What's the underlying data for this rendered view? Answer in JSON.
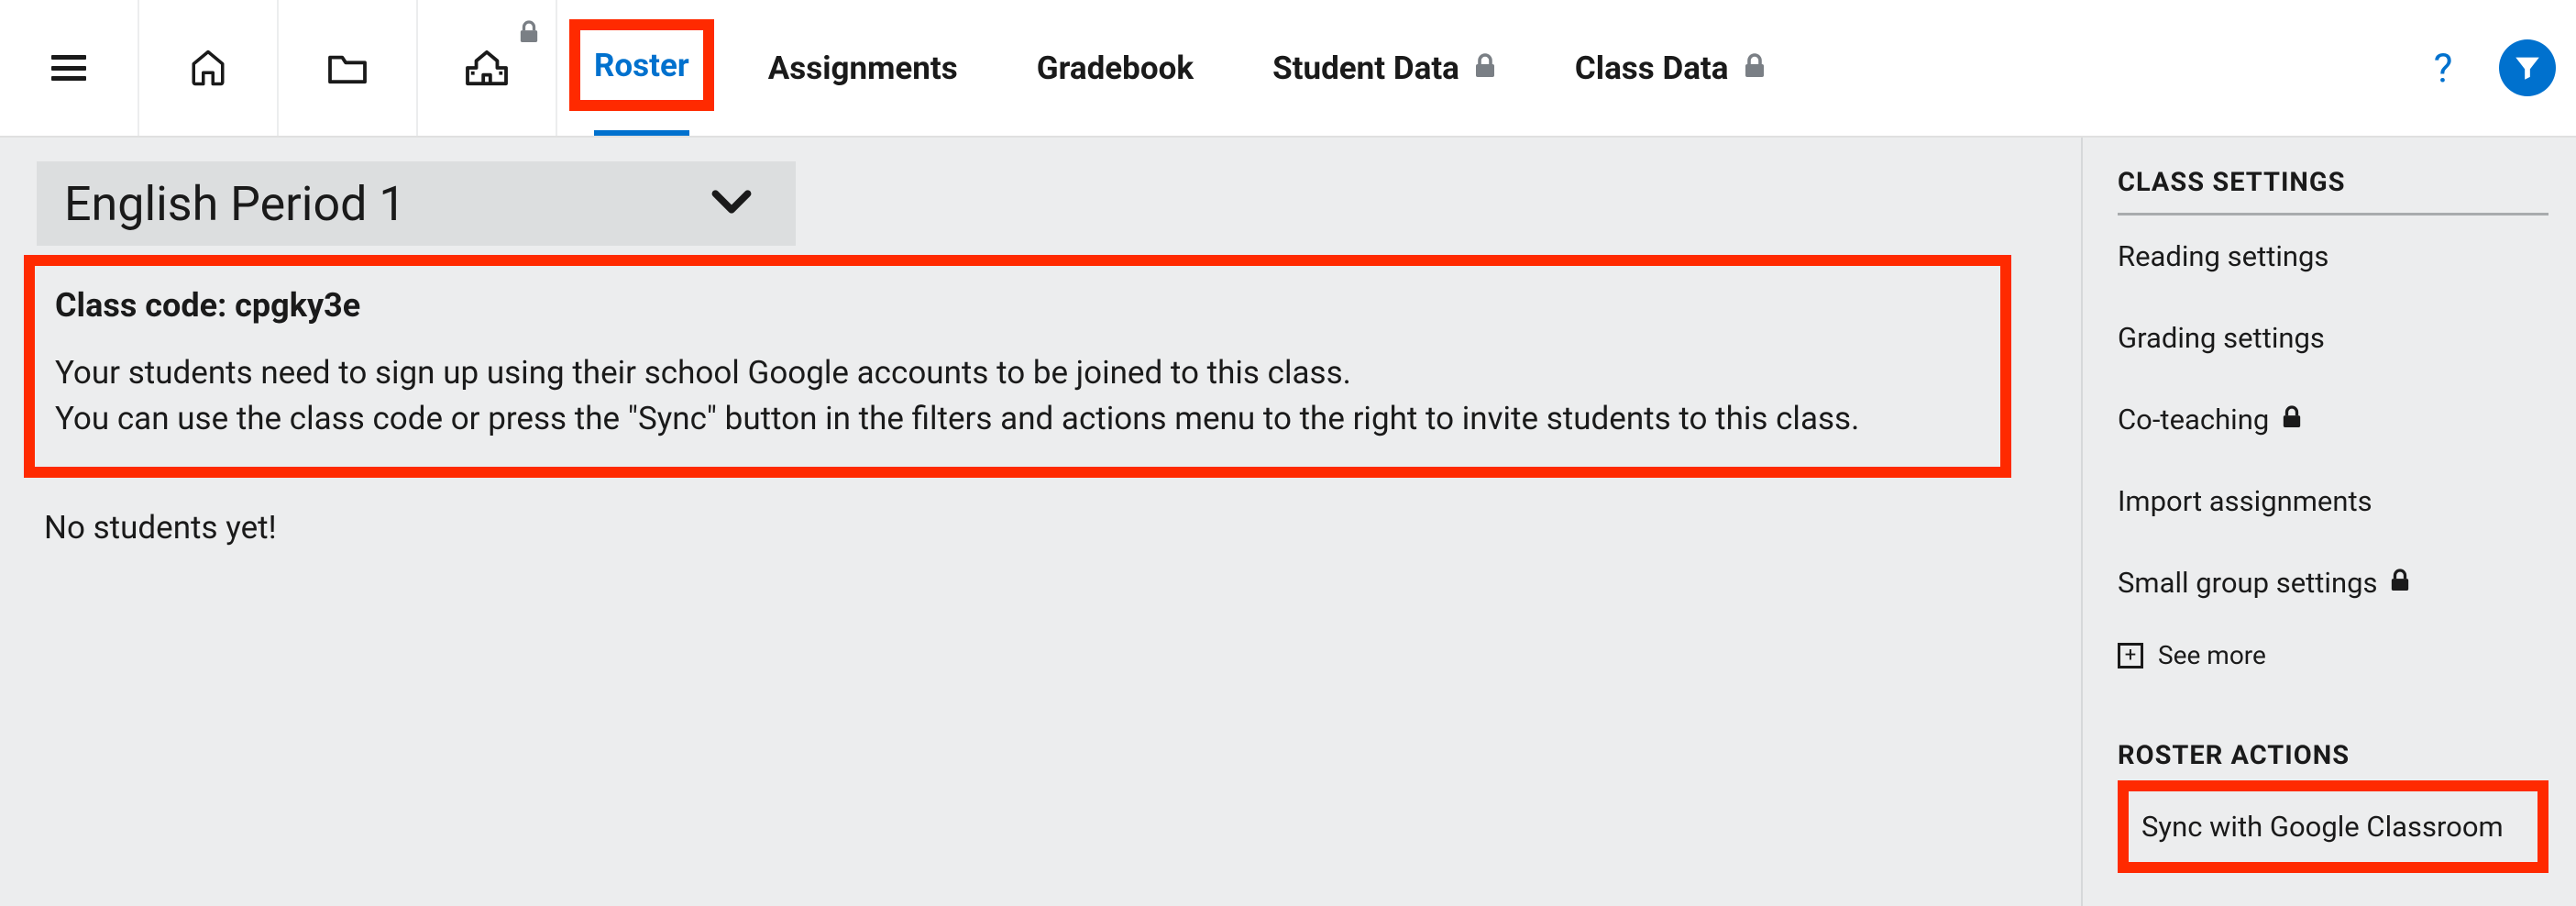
{
  "nav": {
    "tabs": {
      "roster": "Roster",
      "assignments": "Assignments",
      "gradebook": "Gradebook",
      "student_data": "Student Data",
      "class_data": "Class Data"
    }
  },
  "main": {
    "class_name": "English Period 1",
    "class_code_label": "Class code: cpgky3e",
    "info_line1": "Your students need to sign up using their school Google accounts to be joined to this class.",
    "info_line2": "You can use the class code or press the \"Sync\" button in the filters and actions menu to the right to invite students to this class.",
    "no_students": "No students yet!"
  },
  "sidebar": {
    "class_settings_heading": "CLASS SETTINGS",
    "items": {
      "reading": "Reading settings",
      "grading": "Grading settings",
      "coteaching": "Co-teaching",
      "import": "Import assignments",
      "smallgroup": "Small group settings"
    },
    "see_more": "See more",
    "roster_actions_heading": "ROSTER ACTIONS",
    "sync_google": "Sync with Google Classroom"
  }
}
